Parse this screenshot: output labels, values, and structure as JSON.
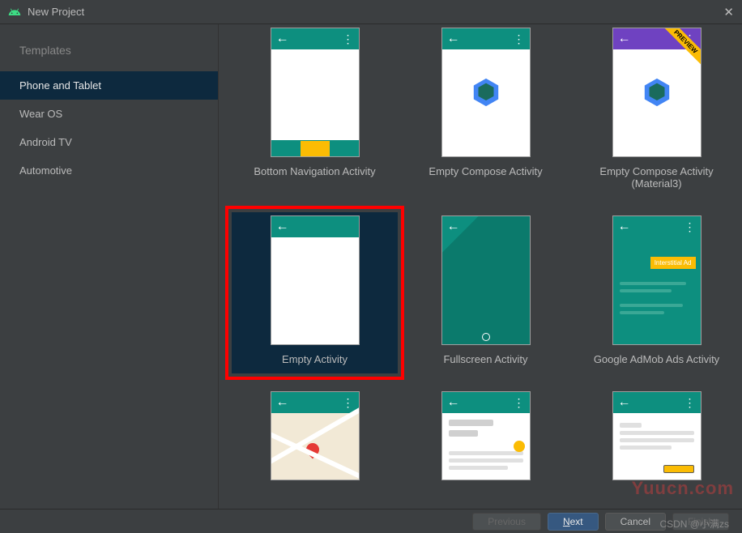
{
  "window": {
    "title": "New Project"
  },
  "sidebar": {
    "header": "Templates",
    "items": [
      {
        "label": "Phone and Tablet",
        "selected": true
      },
      {
        "label": "Wear OS",
        "selected": false
      },
      {
        "label": "Android TV",
        "selected": false
      },
      {
        "label": "Automotive",
        "selected": false
      }
    ]
  },
  "templates": [
    {
      "label": "Bottom Navigation Activity",
      "kind": "bottomnav",
      "selected": false
    },
    {
      "label": "Empty Compose Activity",
      "kind": "compose",
      "selected": false
    },
    {
      "label": "Empty Compose Activity (Material3)",
      "kind": "compose-m3",
      "selected": false,
      "preview_badge": "PREVIEW"
    },
    {
      "label": "Empty Activity",
      "kind": "empty",
      "selected": true
    },
    {
      "label": "Fullscreen Activity",
      "kind": "fullscreen",
      "selected": false
    },
    {
      "label": "Google AdMob Ads Activity",
      "kind": "admob",
      "selected": false,
      "ad_text": "Interstitial Ad"
    },
    {
      "label": "",
      "kind": "maps",
      "selected": false
    },
    {
      "label": "",
      "kind": "list-star",
      "selected": false
    },
    {
      "label": "",
      "kind": "list-btn",
      "selected": false
    }
  ],
  "footer": {
    "previous": "Previous",
    "next": "Next",
    "cancel": "Cancel",
    "finish": "Finish"
  },
  "watermark": "Yuucn.com",
  "watermark2": "CSDN @小满zs"
}
